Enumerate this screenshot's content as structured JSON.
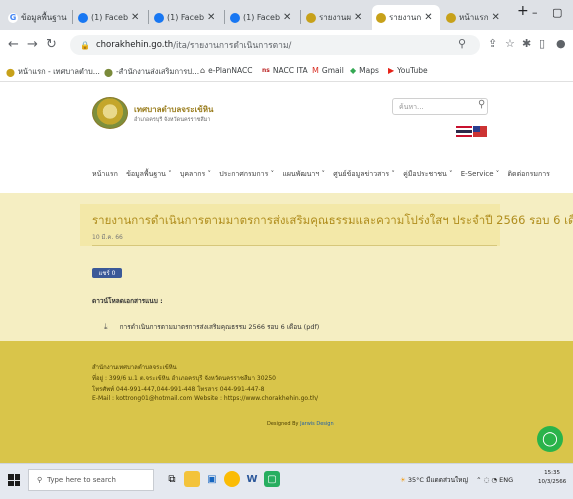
{
  "browser": {
    "tabs": [
      {
        "label": "ข้อมูลพื้นฐาน",
        "icon": "google-icon",
        "color": "#4285f4"
      },
      {
        "label": "(1) Faceb",
        "icon": "facebook-icon",
        "color": "#1877f2"
      },
      {
        "label": "(1) Faceb",
        "icon": "facebook-icon",
        "color": "#1877f2"
      },
      {
        "label": "(1) Faceb",
        "icon": "facebook-icon",
        "color": "#1877f2"
      },
      {
        "label": "รายงานผ",
        "icon": "site-icon",
        "color": "#c7a11a"
      },
      {
        "label": "รายงานก",
        "icon": "site-icon",
        "color": "#c7a11a"
      },
      {
        "label": "หน้าแรก",
        "icon": "site-icon",
        "color": "#c7a11a"
      }
    ],
    "new_tab": "+",
    "window": {
      "dropdown": "⌄",
      "minimize": "–",
      "maximize": "▢"
    },
    "url": {
      "host": "chorakhehin.go.th",
      "path": "/ita/รายงานการดำเนินการตาม/"
    },
    "bookmarks": [
      {
        "label": "หน้าแรก - เทศบาลตำบ...",
        "icon": "site-icon"
      },
      {
        "label": "-สำนักงานส่งเสริมการป...",
        "icon": "site-icon"
      },
      {
        "label": "e-PlanNACC",
        "icon": "home-icon"
      },
      {
        "label": "NACC ITA",
        "icon": "nacc-icon"
      },
      {
        "label": "Gmail",
        "icon": "gmail-icon"
      },
      {
        "label": "Maps",
        "icon": "maps-icon"
      },
      {
        "label": "YouTube",
        "icon": "youtube-icon"
      }
    ]
  },
  "site": {
    "name": "เทศบาลตำบลจระเข้หิน",
    "subtitle": "อำเภอครบุรี จังหวัดนครราชสีมา",
    "search_placeholder": "ค้นหา...",
    "nav": [
      "หน้าแรก",
      "ข้อมูลพื้นฐาน ˅",
      "บุคลากร ˅",
      "ประกาศกรมการ ˅",
      "แผนพัฒนาฯ ˅",
      "ศูนย์ข้อมูลข่าวสาร ˅",
      "คู่มือประชาชน ˅",
      "E-Service ˅",
      "ติดต่อกรมการ"
    ]
  },
  "article": {
    "title": "รายงานการดำเนินการตามมาตรการส่งเสริมคุณธรรมและความโปร่งใสฯ ประจำปี 2566 รอบ 6 เดือน",
    "date": "10 มี.ค. 66",
    "share_label": "แชร์ 0",
    "attachments_label": "ดาวน์โหลดเอกสารแนบ :",
    "attachment": "การดำเนินการตามมาตรการส่งเสริมคุณธรรม 2566 รอบ 6 เดือน (pdf)"
  },
  "footer": {
    "org": "สำนักงานเทศบาลตำบลจระเข้หิน",
    "address": "ที่อยู่ : 399/6 ม.1 ต.จระเข้หิน อำเภอครบุรี จังหวัดนครราชสีมา 30250",
    "phone": "โทรศัพท์ 044-991-447,044-991-448 โทรสาร 044-991-447-8",
    "email": "E-Mail : kottrong01@hotmail.com  Website : https://www.chorakhehin.go.th/",
    "designed_by": "Designed By",
    "designer": "Jarwis Design"
  },
  "taskbar": {
    "search_placeholder": "Type here to search",
    "weather": "35°C มีแดดส่วนใหญ่",
    "lang": "ENG",
    "time": "15:35",
    "date": "10/3/2566"
  },
  "colors": {
    "accent": "#b08d1d",
    "main_bg": "#f5eec2",
    "footer_bg": "#d9c54a"
  }
}
